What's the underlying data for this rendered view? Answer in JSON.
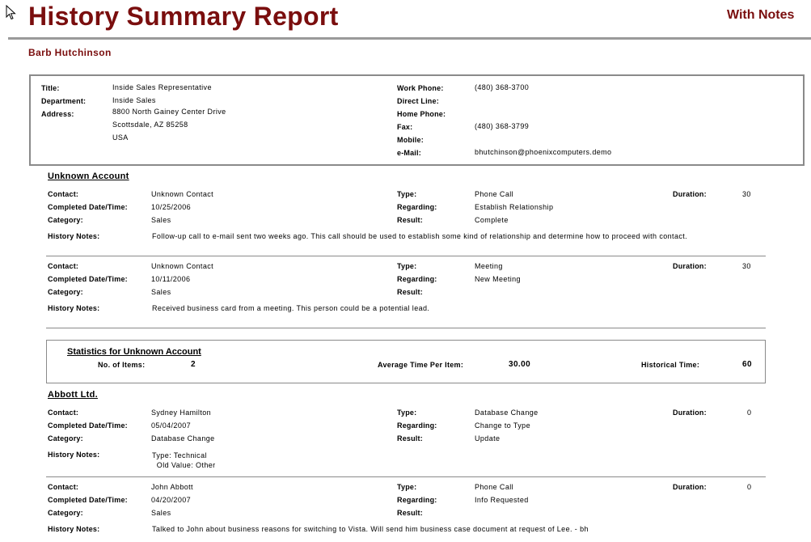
{
  "report": {
    "title": "History Summary Report",
    "notes_flag": "With Notes",
    "person_name": "Barb Hutchinson"
  },
  "profile": {
    "labels": {
      "title": "Title:",
      "department": "Department:",
      "address": "Address:",
      "work_phone": "Work Phone:",
      "direct_line": "Direct Line:",
      "home_phone": "Home Phone:",
      "fax": "Fax:",
      "mobile": "Mobile:",
      "email": "e-Mail:"
    },
    "title": "Inside Sales Representative",
    "department": "Inside Sales",
    "address_lines": [
      "8800 North Gainey Center Drive",
      "Scottsdale, AZ  85258",
      "USA"
    ],
    "work_phone": "(480) 368-3700",
    "direct_line": "",
    "home_phone": "",
    "fax": "(480) 368-3799",
    "mobile": "",
    "email": "bhutchinson@phoenixcomputers.demo"
  },
  "field_labels": {
    "contact": "Contact:",
    "completed": "Completed Date/Time:",
    "category": "Category:",
    "notes": "History Notes:",
    "type": "Type:",
    "regarding": "Regarding:",
    "result": "Result:",
    "duration": "Duration:"
  },
  "accounts": [
    {
      "name": "Unknown Account",
      "entries": [
        {
          "contact": "Unknown Contact",
          "completed": "10/25/2006",
          "category": "Sales",
          "type": "Phone Call",
          "regarding": "Establish Relationship",
          "result": "Complete",
          "duration": "30",
          "notes": [
            "Follow-up call to e-mail sent two weeks ago.  This call should be used to establish some kind of relationship and determine how to proceed with contact."
          ]
        },
        {
          "contact": "Unknown Contact",
          "completed": "10/11/2006",
          "category": "Sales",
          "type": "Meeting",
          "regarding": "New Meeting",
          "result": "",
          "duration": "30",
          "notes": [
            "Received business card from a meeting.  This person could be a potential lead."
          ]
        }
      ],
      "stats": {
        "title": "Statistics for Unknown Account",
        "items_label": "No. of Items:",
        "items_value": "2",
        "avg_label": "Average Time Per Item:",
        "avg_value": "30.00",
        "hist_label": "Historical Time:",
        "hist_value": "60"
      }
    },
    {
      "name": "Abbott Ltd.",
      "entries": [
        {
          "contact": "Sydney  Hamilton",
          "completed": "05/04/2007",
          "category": "Database Change",
          "type": "Database Change",
          "regarding": "Change to Type",
          "result": "Update",
          "duration": "0",
          "notes": [
            "Type: Technical",
            "  Old Value: Other"
          ]
        },
        {
          "contact": "John  Abbott",
          "completed": "04/20/2007",
          "category": "Sales",
          "type": "Phone Call",
          "regarding": "Info Requested",
          "result": "",
          "duration": "0",
          "notes": [
            "Talked to John about business reasons for switching to Vista.  Will send him business case document at request of Lee. - bh"
          ]
        }
      ]
    }
  ]
}
